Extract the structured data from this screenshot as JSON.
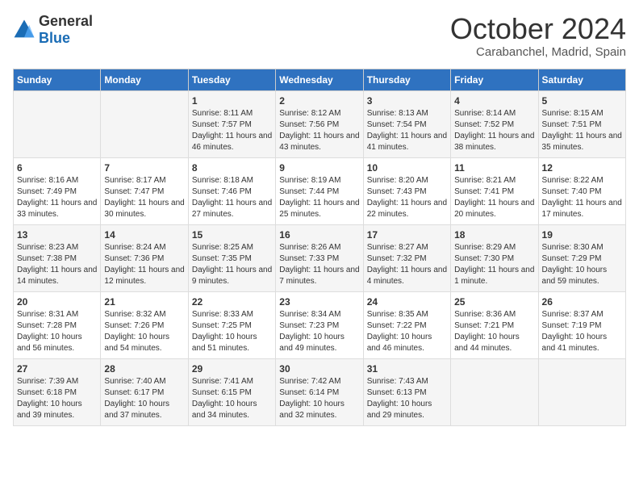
{
  "header": {
    "logo_general": "General",
    "logo_blue": "Blue",
    "month": "October 2024",
    "location": "Carabanchel, Madrid, Spain"
  },
  "weekdays": [
    "Sunday",
    "Monday",
    "Tuesday",
    "Wednesday",
    "Thursday",
    "Friday",
    "Saturday"
  ],
  "weeks": [
    [
      {
        "day": "",
        "info": ""
      },
      {
        "day": "",
        "info": ""
      },
      {
        "day": "1",
        "info": "Sunrise: 8:11 AM\nSunset: 7:57 PM\nDaylight: 11 hours and 46 minutes."
      },
      {
        "day": "2",
        "info": "Sunrise: 8:12 AM\nSunset: 7:56 PM\nDaylight: 11 hours and 43 minutes."
      },
      {
        "day": "3",
        "info": "Sunrise: 8:13 AM\nSunset: 7:54 PM\nDaylight: 11 hours and 41 minutes."
      },
      {
        "day": "4",
        "info": "Sunrise: 8:14 AM\nSunset: 7:52 PM\nDaylight: 11 hours and 38 minutes."
      },
      {
        "day": "5",
        "info": "Sunrise: 8:15 AM\nSunset: 7:51 PM\nDaylight: 11 hours and 35 minutes."
      }
    ],
    [
      {
        "day": "6",
        "info": "Sunrise: 8:16 AM\nSunset: 7:49 PM\nDaylight: 11 hours and 33 minutes."
      },
      {
        "day": "7",
        "info": "Sunrise: 8:17 AM\nSunset: 7:47 PM\nDaylight: 11 hours and 30 minutes."
      },
      {
        "day": "8",
        "info": "Sunrise: 8:18 AM\nSunset: 7:46 PM\nDaylight: 11 hours and 27 minutes."
      },
      {
        "day": "9",
        "info": "Sunrise: 8:19 AM\nSunset: 7:44 PM\nDaylight: 11 hours and 25 minutes."
      },
      {
        "day": "10",
        "info": "Sunrise: 8:20 AM\nSunset: 7:43 PM\nDaylight: 11 hours and 22 minutes."
      },
      {
        "day": "11",
        "info": "Sunrise: 8:21 AM\nSunset: 7:41 PM\nDaylight: 11 hours and 20 minutes."
      },
      {
        "day": "12",
        "info": "Sunrise: 8:22 AM\nSunset: 7:40 PM\nDaylight: 11 hours and 17 minutes."
      }
    ],
    [
      {
        "day": "13",
        "info": "Sunrise: 8:23 AM\nSunset: 7:38 PM\nDaylight: 11 hours and 14 minutes."
      },
      {
        "day": "14",
        "info": "Sunrise: 8:24 AM\nSunset: 7:36 PM\nDaylight: 11 hours and 12 minutes."
      },
      {
        "day": "15",
        "info": "Sunrise: 8:25 AM\nSunset: 7:35 PM\nDaylight: 11 hours and 9 minutes."
      },
      {
        "day": "16",
        "info": "Sunrise: 8:26 AM\nSunset: 7:33 PM\nDaylight: 11 hours and 7 minutes."
      },
      {
        "day": "17",
        "info": "Sunrise: 8:27 AM\nSunset: 7:32 PM\nDaylight: 11 hours and 4 minutes."
      },
      {
        "day": "18",
        "info": "Sunrise: 8:29 AM\nSunset: 7:30 PM\nDaylight: 11 hours and 1 minute."
      },
      {
        "day": "19",
        "info": "Sunrise: 8:30 AM\nSunset: 7:29 PM\nDaylight: 10 hours and 59 minutes."
      }
    ],
    [
      {
        "day": "20",
        "info": "Sunrise: 8:31 AM\nSunset: 7:28 PM\nDaylight: 10 hours and 56 minutes."
      },
      {
        "day": "21",
        "info": "Sunrise: 8:32 AM\nSunset: 7:26 PM\nDaylight: 10 hours and 54 minutes."
      },
      {
        "day": "22",
        "info": "Sunrise: 8:33 AM\nSunset: 7:25 PM\nDaylight: 10 hours and 51 minutes."
      },
      {
        "day": "23",
        "info": "Sunrise: 8:34 AM\nSunset: 7:23 PM\nDaylight: 10 hours and 49 minutes."
      },
      {
        "day": "24",
        "info": "Sunrise: 8:35 AM\nSunset: 7:22 PM\nDaylight: 10 hours and 46 minutes."
      },
      {
        "day": "25",
        "info": "Sunrise: 8:36 AM\nSunset: 7:21 PM\nDaylight: 10 hours and 44 minutes."
      },
      {
        "day": "26",
        "info": "Sunrise: 8:37 AM\nSunset: 7:19 PM\nDaylight: 10 hours and 41 minutes."
      }
    ],
    [
      {
        "day": "27",
        "info": "Sunrise: 7:39 AM\nSunset: 6:18 PM\nDaylight: 10 hours and 39 minutes."
      },
      {
        "day": "28",
        "info": "Sunrise: 7:40 AM\nSunset: 6:17 PM\nDaylight: 10 hours and 37 minutes."
      },
      {
        "day": "29",
        "info": "Sunrise: 7:41 AM\nSunset: 6:15 PM\nDaylight: 10 hours and 34 minutes."
      },
      {
        "day": "30",
        "info": "Sunrise: 7:42 AM\nSunset: 6:14 PM\nDaylight: 10 hours and 32 minutes."
      },
      {
        "day": "31",
        "info": "Sunrise: 7:43 AM\nSunset: 6:13 PM\nDaylight: 10 hours and 29 minutes."
      },
      {
        "day": "",
        "info": ""
      },
      {
        "day": "",
        "info": ""
      }
    ]
  ]
}
